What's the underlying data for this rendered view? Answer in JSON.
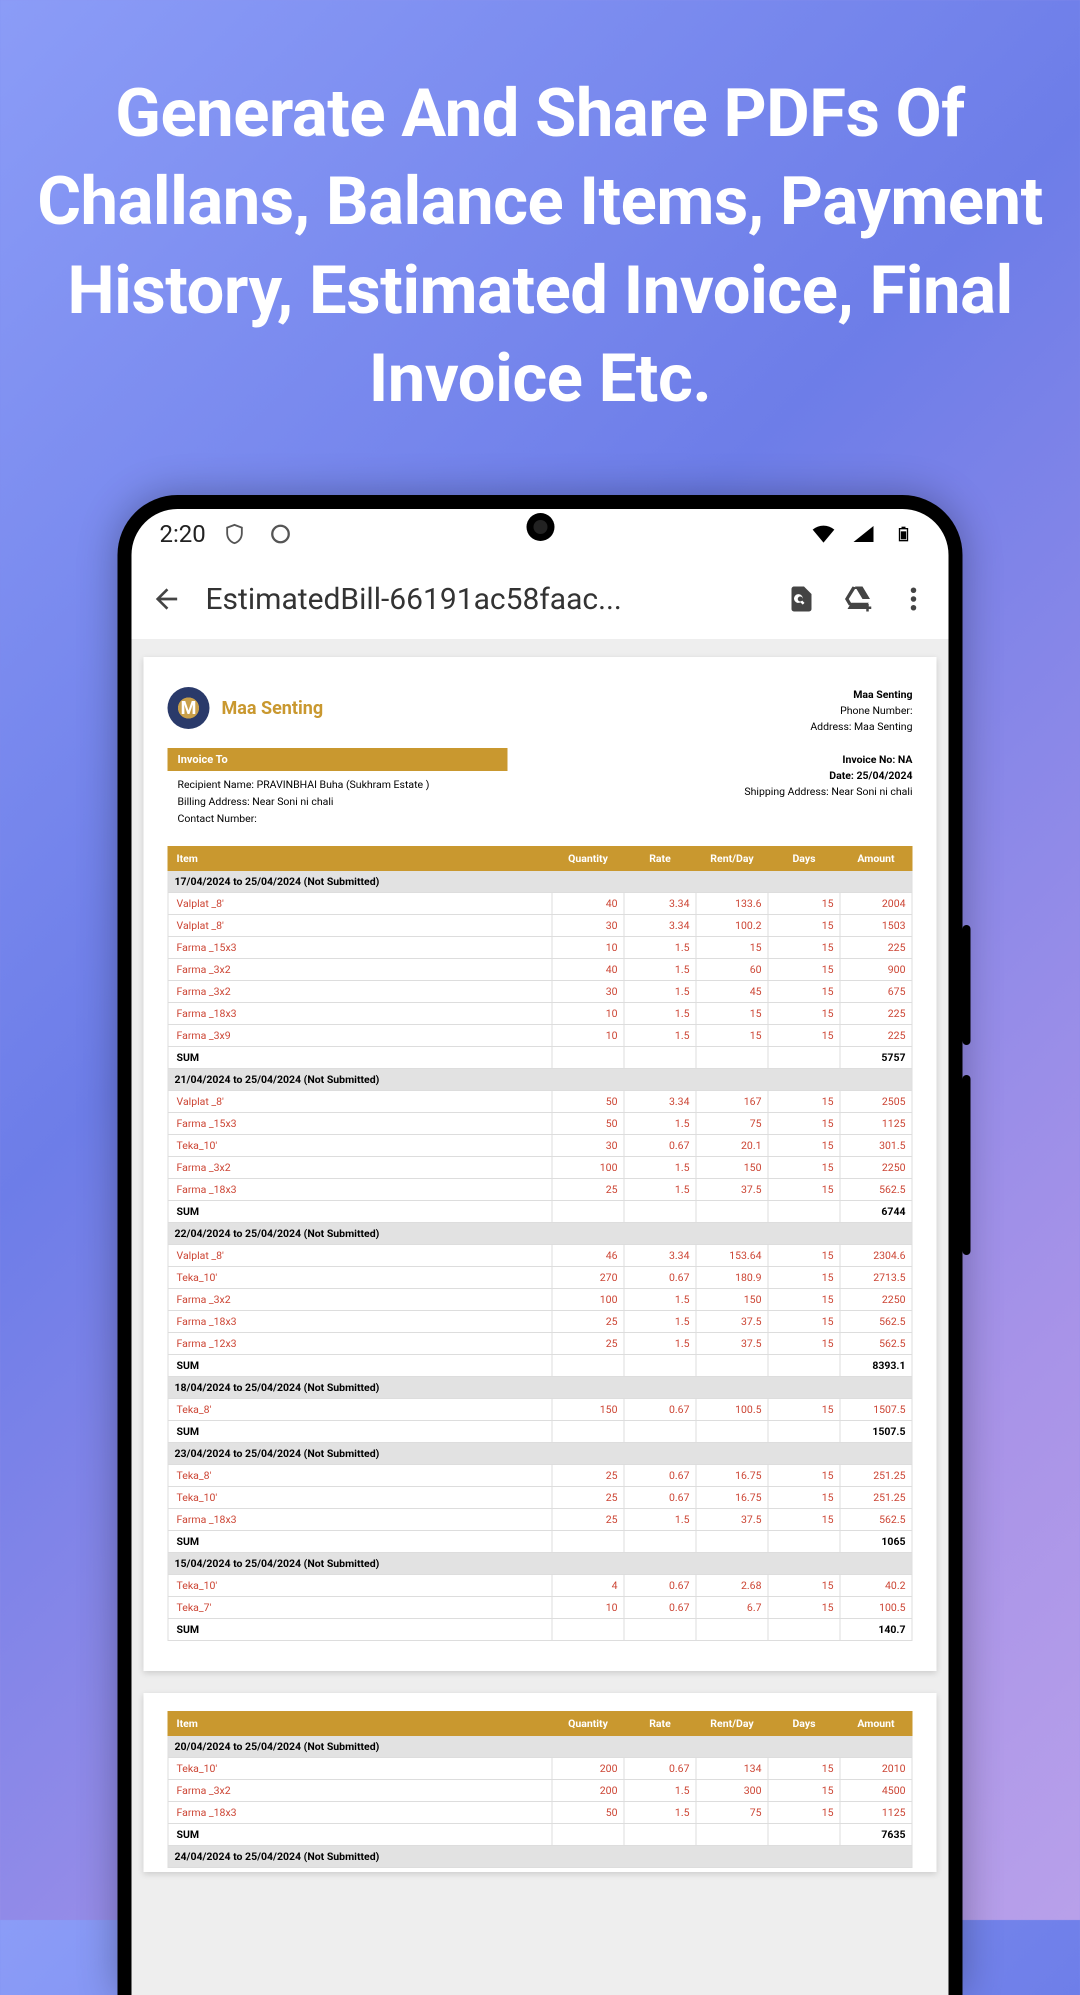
{
  "headline": "Generate And Share PDFs Of Challans, Balance Items, Payment History, Estimated Invoice, Final Invoice Etc.",
  "status": {
    "time": "2:20"
  },
  "appbar": {
    "title": "EstimatedBill-66191ac58faac..."
  },
  "doc": {
    "company": "Maa Senting",
    "hdr_company": "Maa Senting",
    "hdr_phone_label": "Phone Number:",
    "hdr_addr": "Address: Maa Senting",
    "ito_title": "Invoice To",
    "ito_recipient": "Recipient Name: PRAVINBHAI Buha (Sukhram Estate )",
    "ito_billing": "Billing Address: Near Soni ni chali",
    "ito_contact": "Contact Number:",
    "meta_inv": "Invoice No: NA",
    "meta_date": "Date: 25/04/2024",
    "meta_ship": "Shipping Address: Near Soni ni chali",
    "cols": {
      "item": "Item",
      "qty": "Quantity",
      "rate": "Rate",
      "rent": "Rent/Day",
      "days": "Days",
      "amt": "Amount"
    },
    "sum_label": "SUM",
    "groups": [
      {
        "title": "17/04/2024 to 25/04/2024 (Not Submitted)",
        "rows": [
          {
            "item": "Valplat _8'",
            "qty": "40",
            "rate": "3.34",
            "rent": "133.6",
            "days": "15",
            "amt": "2004"
          },
          {
            "item": "Valplat _8'",
            "qty": "30",
            "rate": "3.34",
            "rent": "100.2",
            "days": "15",
            "amt": "1503"
          },
          {
            "item": "Farma _15x3",
            "qty": "10",
            "rate": "1.5",
            "rent": "15",
            "days": "15",
            "amt": "225"
          },
          {
            "item": "Farma _3x2",
            "qty": "40",
            "rate": "1.5",
            "rent": "60",
            "days": "15",
            "amt": "900"
          },
          {
            "item": "Farma _3x2",
            "qty": "30",
            "rate": "1.5",
            "rent": "45",
            "days": "15",
            "amt": "675"
          },
          {
            "item": "Farma _18x3",
            "qty": "10",
            "rate": "1.5",
            "rent": "15",
            "days": "15",
            "amt": "225"
          },
          {
            "item": "Farma _3x9",
            "qty": "10",
            "rate": "1.5",
            "rent": "15",
            "days": "15",
            "amt": "225"
          }
        ],
        "sum": "5757"
      },
      {
        "title": "21/04/2024 to 25/04/2024 (Not Submitted)",
        "rows": [
          {
            "item": "Valplat _8'",
            "qty": "50",
            "rate": "3.34",
            "rent": "167",
            "days": "15",
            "amt": "2505"
          },
          {
            "item": "Farma _15x3",
            "qty": "50",
            "rate": "1.5",
            "rent": "75",
            "days": "15",
            "amt": "1125"
          },
          {
            "item": "Teka_10'",
            "qty": "30",
            "rate": "0.67",
            "rent": "20.1",
            "days": "15",
            "amt": "301.5"
          },
          {
            "item": "Farma _3x2",
            "qty": "100",
            "rate": "1.5",
            "rent": "150",
            "days": "15",
            "amt": "2250"
          },
          {
            "item": "Farma _18x3",
            "qty": "25",
            "rate": "1.5",
            "rent": "37.5",
            "days": "15",
            "amt": "562.5"
          }
        ],
        "sum": "6744"
      },
      {
        "title": "22/04/2024 to 25/04/2024 (Not Submitted)",
        "rows": [
          {
            "item": "Valplat _8'",
            "qty": "46",
            "rate": "3.34",
            "rent": "153.64",
            "days": "15",
            "amt": "2304.6"
          },
          {
            "item": "Teka_10'",
            "qty": "270",
            "rate": "0.67",
            "rent": "180.9",
            "days": "15",
            "amt": "2713.5"
          },
          {
            "item": "Farma _3x2",
            "qty": "100",
            "rate": "1.5",
            "rent": "150",
            "days": "15",
            "amt": "2250"
          },
          {
            "item": "Farma _18x3",
            "qty": "25",
            "rate": "1.5",
            "rent": "37.5",
            "days": "15",
            "amt": "562.5"
          },
          {
            "item": "Farma _12x3",
            "qty": "25",
            "rate": "1.5",
            "rent": "37.5",
            "days": "15",
            "amt": "562.5"
          }
        ],
        "sum": "8393.1"
      },
      {
        "title": "18/04/2024 to 25/04/2024 (Not Submitted)",
        "rows": [
          {
            "item": "Teka_8'",
            "qty": "150",
            "rate": "0.67",
            "rent": "100.5",
            "days": "15",
            "amt": "1507.5"
          }
        ],
        "sum": "1507.5"
      },
      {
        "title": "23/04/2024 to 25/04/2024 (Not Submitted)",
        "rows": [
          {
            "item": "Teka_8'",
            "qty": "25",
            "rate": "0.67",
            "rent": "16.75",
            "days": "15",
            "amt": "251.25"
          },
          {
            "item": "Teka_10'",
            "qty": "25",
            "rate": "0.67",
            "rent": "16.75",
            "days": "15",
            "amt": "251.25"
          },
          {
            "item": "Farma _18x3",
            "qty": "25",
            "rate": "1.5",
            "rent": "37.5",
            "days": "15",
            "amt": "562.5"
          }
        ],
        "sum": "1065"
      },
      {
        "title": "15/04/2024 to 25/04/2024 (Not Submitted)",
        "rows": [
          {
            "item": "Teka_10'",
            "qty": "4",
            "rate": "0.67",
            "rent": "2.68",
            "days": "15",
            "amt": "40.2"
          },
          {
            "item": "Teka_7'",
            "qty": "10",
            "rate": "0.67",
            "rent": "6.7",
            "days": "15",
            "amt": "100.5"
          }
        ],
        "sum": "140.7"
      }
    ],
    "groups2": [
      {
        "title": "20/04/2024 to 25/04/2024 (Not Submitted)",
        "rows": [
          {
            "item": "Teka_10'",
            "qty": "200",
            "rate": "0.67",
            "rent": "134",
            "days": "15",
            "amt": "2010"
          },
          {
            "item": "Farma _3x2",
            "qty": "200",
            "rate": "1.5",
            "rent": "300",
            "days": "15",
            "amt": "4500"
          },
          {
            "item": "Farma _18x3",
            "qty": "50",
            "rate": "1.5",
            "rent": "75",
            "days": "15",
            "amt": "1125"
          }
        ],
        "sum": "7635"
      },
      {
        "title": "24/04/2024 to 25/04/2024 (Not Submitted)",
        "rows": []
      }
    ]
  }
}
